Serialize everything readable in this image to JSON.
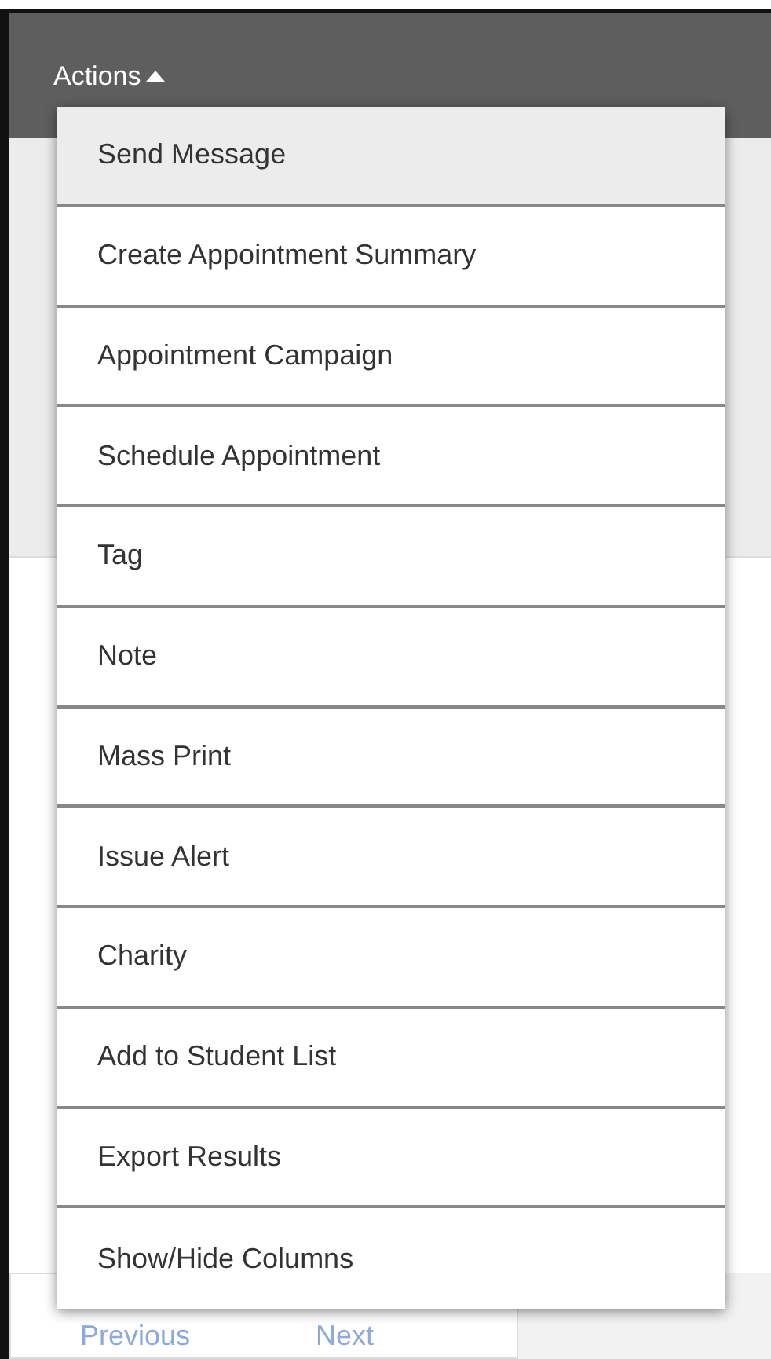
{
  "actions_button": {
    "label": "Actions",
    "expanded": true
  },
  "menu": {
    "items": [
      {
        "label": "Send Message",
        "selected": true
      },
      {
        "label": "Create Appointment Summary",
        "selected": false
      },
      {
        "label": "Appointment Campaign",
        "selected": false
      },
      {
        "label": "Schedule Appointment",
        "selected": false
      },
      {
        "label": "Tag",
        "selected": false
      },
      {
        "label": "Note",
        "selected": false
      },
      {
        "label": "Mass Print",
        "selected": false
      },
      {
        "label": "Issue Alert",
        "selected": false
      },
      {
        "label": "Charity",
        "selected": false
      },
      {
        "label": "Add to Student List",
        "selected": false
      },
      {
        "label": "Export Results",
        "selected": false
      },
      {
        "label": "Show/Hide Columns",
        "selected": false
      }
    ]
  },
  "pagination": {
    "previous": "Previous",
    "next": "Next"
  }
}
